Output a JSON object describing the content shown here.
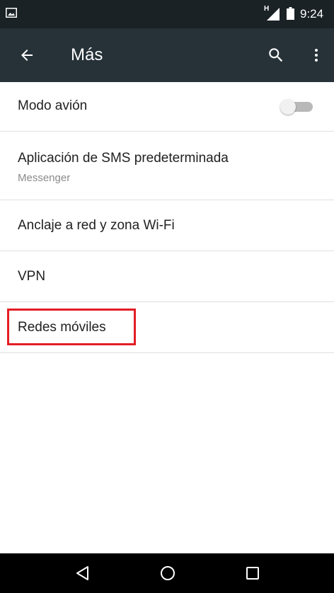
{
  "status_bar": {
    "time": "9:24",
    "network_type": "H",
    "icons": [
      "gallery-icon",
      "signal-icon",
      "battery-icon"
    ]
  },
  "app_bar": {
    "title": "Más",
    "icons": [
      "back-arrow-icon",
      "search-icon",
      "more-vert-icon"
    ]
  },
  "settings": {
    "items": [
      {
        "title": "Modo avión",
        "subtitle": "",
        "toggle_on": false
      },
      {
        "title": "Aplicación de SMS predeterminada",
        "subtitle": "Messenger"
      },
      {
        "title": "Anclaje a red y zona Wi-Fi",
        "subtitle": ""
      },
      {
        "title": "VPN",
        "subtitle": ""
      },
      {
        "title": "Redes móviles",
        "subtitle": "",
        "highlighted": true
      }
    ]
  },
  "nav_bar": {
    "icons": [
      "back-triangle-icon",
      "home-circle-icon",
      "recents-square-icon"
    ]
  },
  "colors": {
    "status_bar": "#1a2226",
    "app_bar": "#263238",
    "highlight": "#e31e24",
    "divider": "#e0e0e0",
    "primary_text": "#212121",
    "secondary_text": "#8a8a8a",
    "nav_bar": "#000000"
  }
}
